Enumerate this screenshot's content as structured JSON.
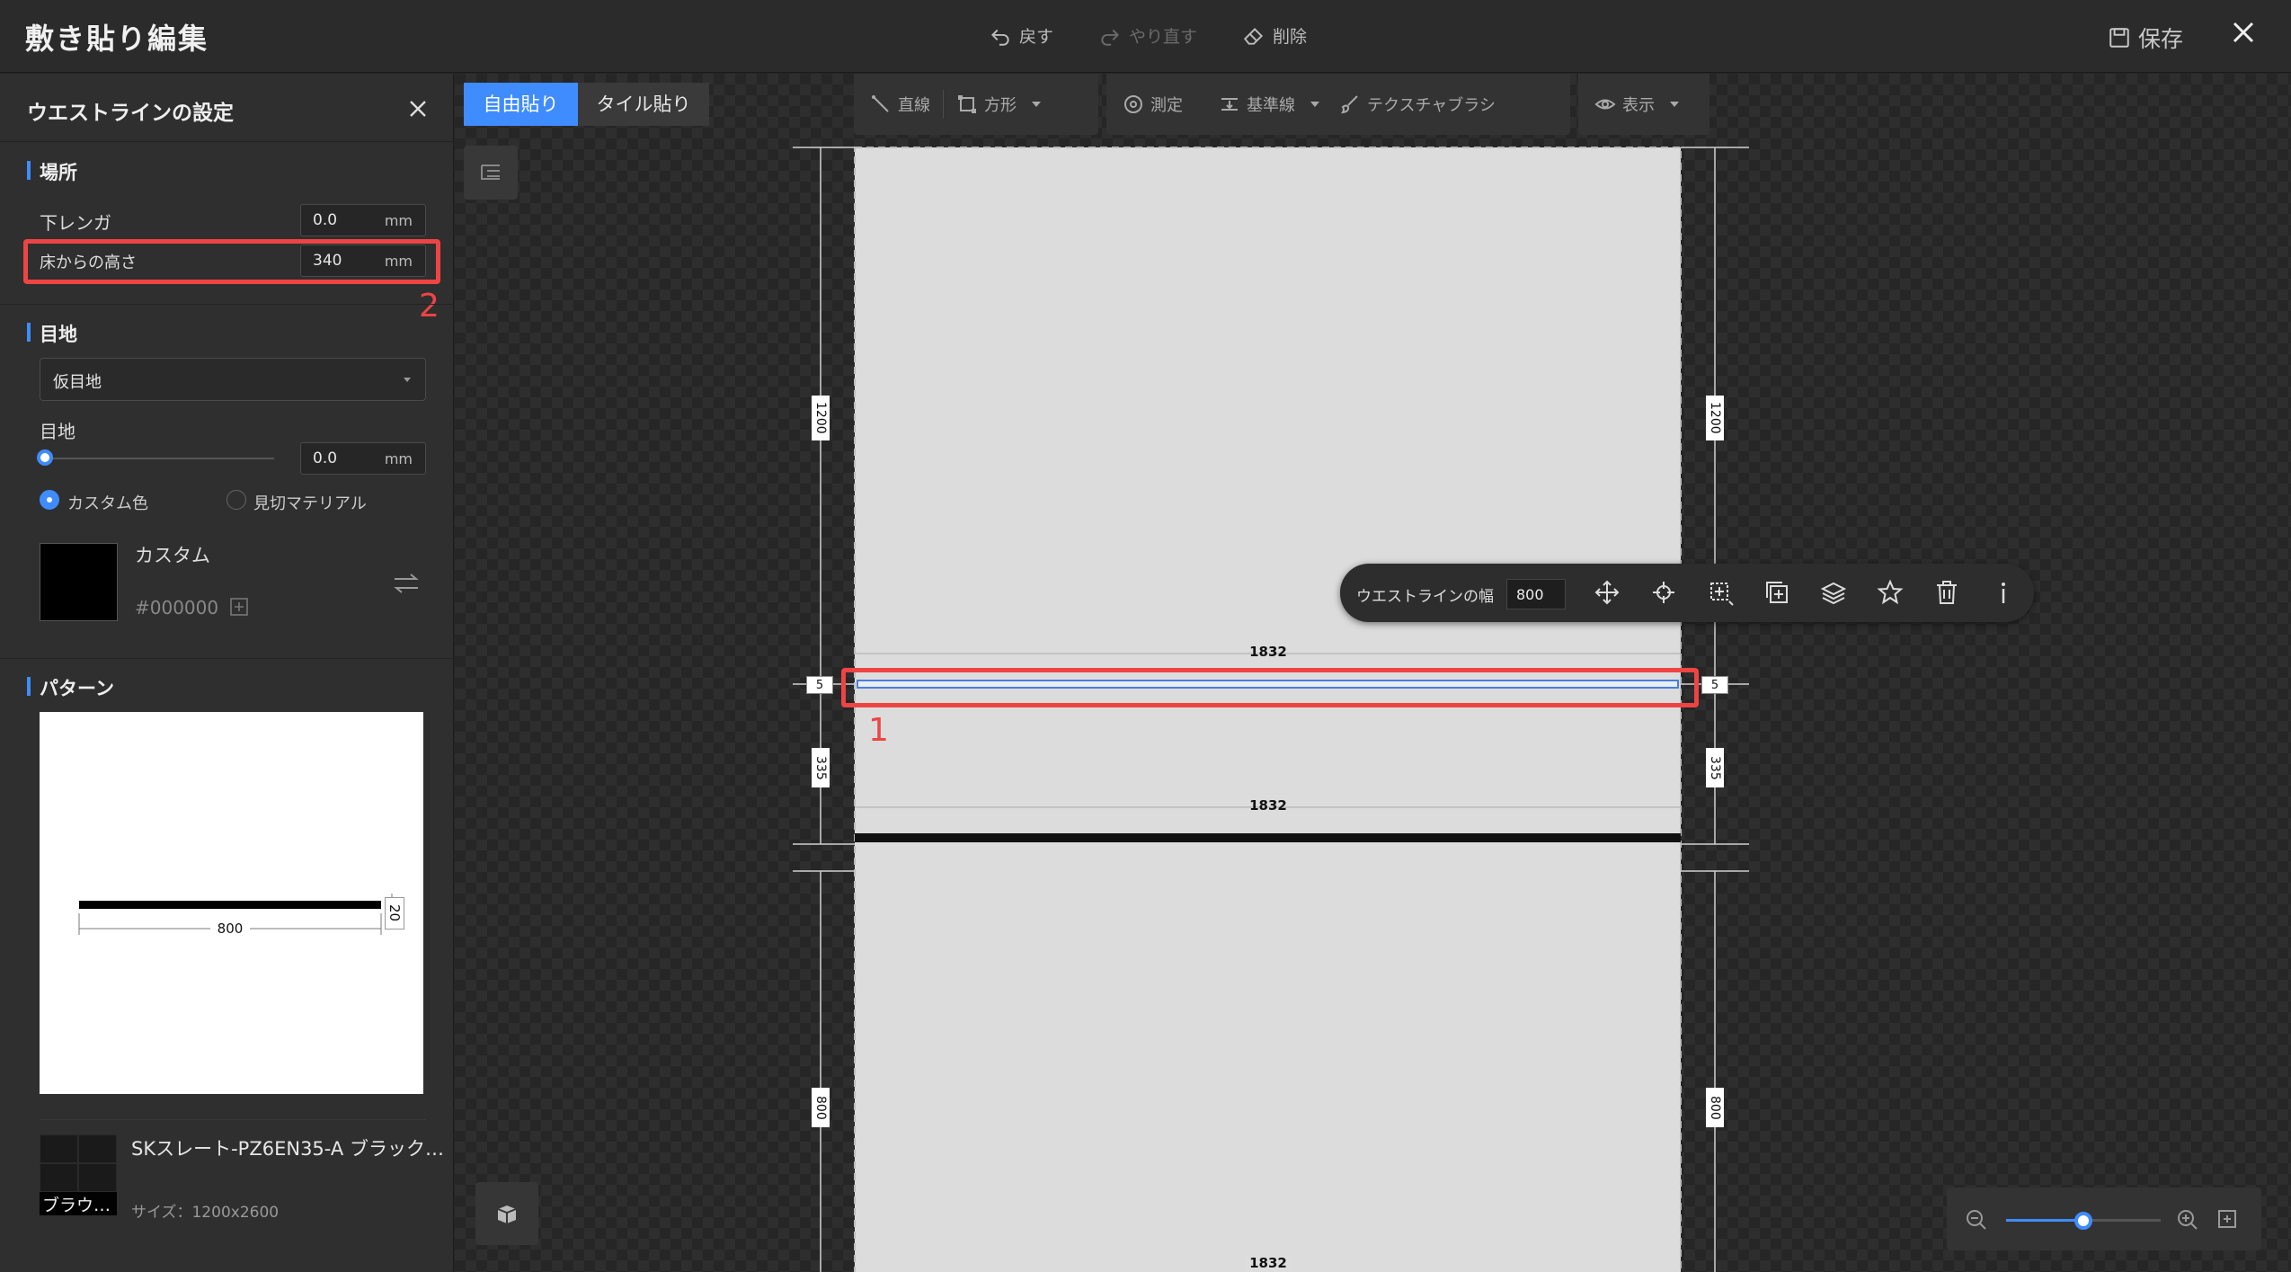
{
  "app": {
    "title": "敷き貼り編集",
    "undo_label": "戻す",
    "redo_label": "やり直す",
    "delete_label": "削除",
    "save_label": "保存"
  },
  "panel": {
    "title": "ウエストラインの設定",
    "location": {
      "section_title": "場所",
      "lower_brick_label": "下レンガ",
      "lower_brick_value": "0.0",
      "height_label": "床からの高さ",
      "height_value": "340",
      "unit": "mm"
    },
    "joint": {
      "section_title": "目地",
      "type_value": "仮目地",
      "width_label": "目地",
      "width_value": "0.0",
      "width_fraction": 0,
      "unit": "mm",
      "color_options": [
        {
          "label": "カスタム色",
          "checked": true
        },
        {
          "label": "見切マテリアル",
          "checked": false
        }
      ],
      "custom_name": "カスタム",
      "custom_hex": "#000000"
    },
    "pattern": {
      "section_title": "パターン",
      "width_dim": "800",
      "height_dim": "20",
      "material_name": "SKスレート-PZ6EN35-A ブラック…",
      "material_thumb_caption": "ブラウ…",
      "material_size": "サイズ：1200x2600"
    }
  },
  "canvas": {
    "mode_tabs": [
      {
        "label": "自由貼り",
        "active": true
      },
      {
        "label": "タイル貼り",
        "active": false
      }
    ],
    "toolbar": {
      "line": "直線",
      "rect": "方形",
      "measure": "測定",
      "baseline": "基準線",
      "texture_brush": "テクスチャブラシ",
      "display": "表示"
    },
    "context_bar": {
      "width_label": "ウエストラインの幅",
      "width_value": "800"
    },
    "dims": {
      "top_height": "1200",
      "gap": "5",
      "mid_height": "335",
      "bottom_height": "800",
      "width": "1832"
    },
    "zoom_fraction": 0.5
  },
  "annotations": {
    "marker_1": "1",
    "marker_2": "2"
  },
  "colors": {
    "accent": "#3f8cff",
    "annotation": "#ee4444",
    "panel_bg": "#2f2f2f",
    "wall_fill": "#dcdcdc"
  }
}
